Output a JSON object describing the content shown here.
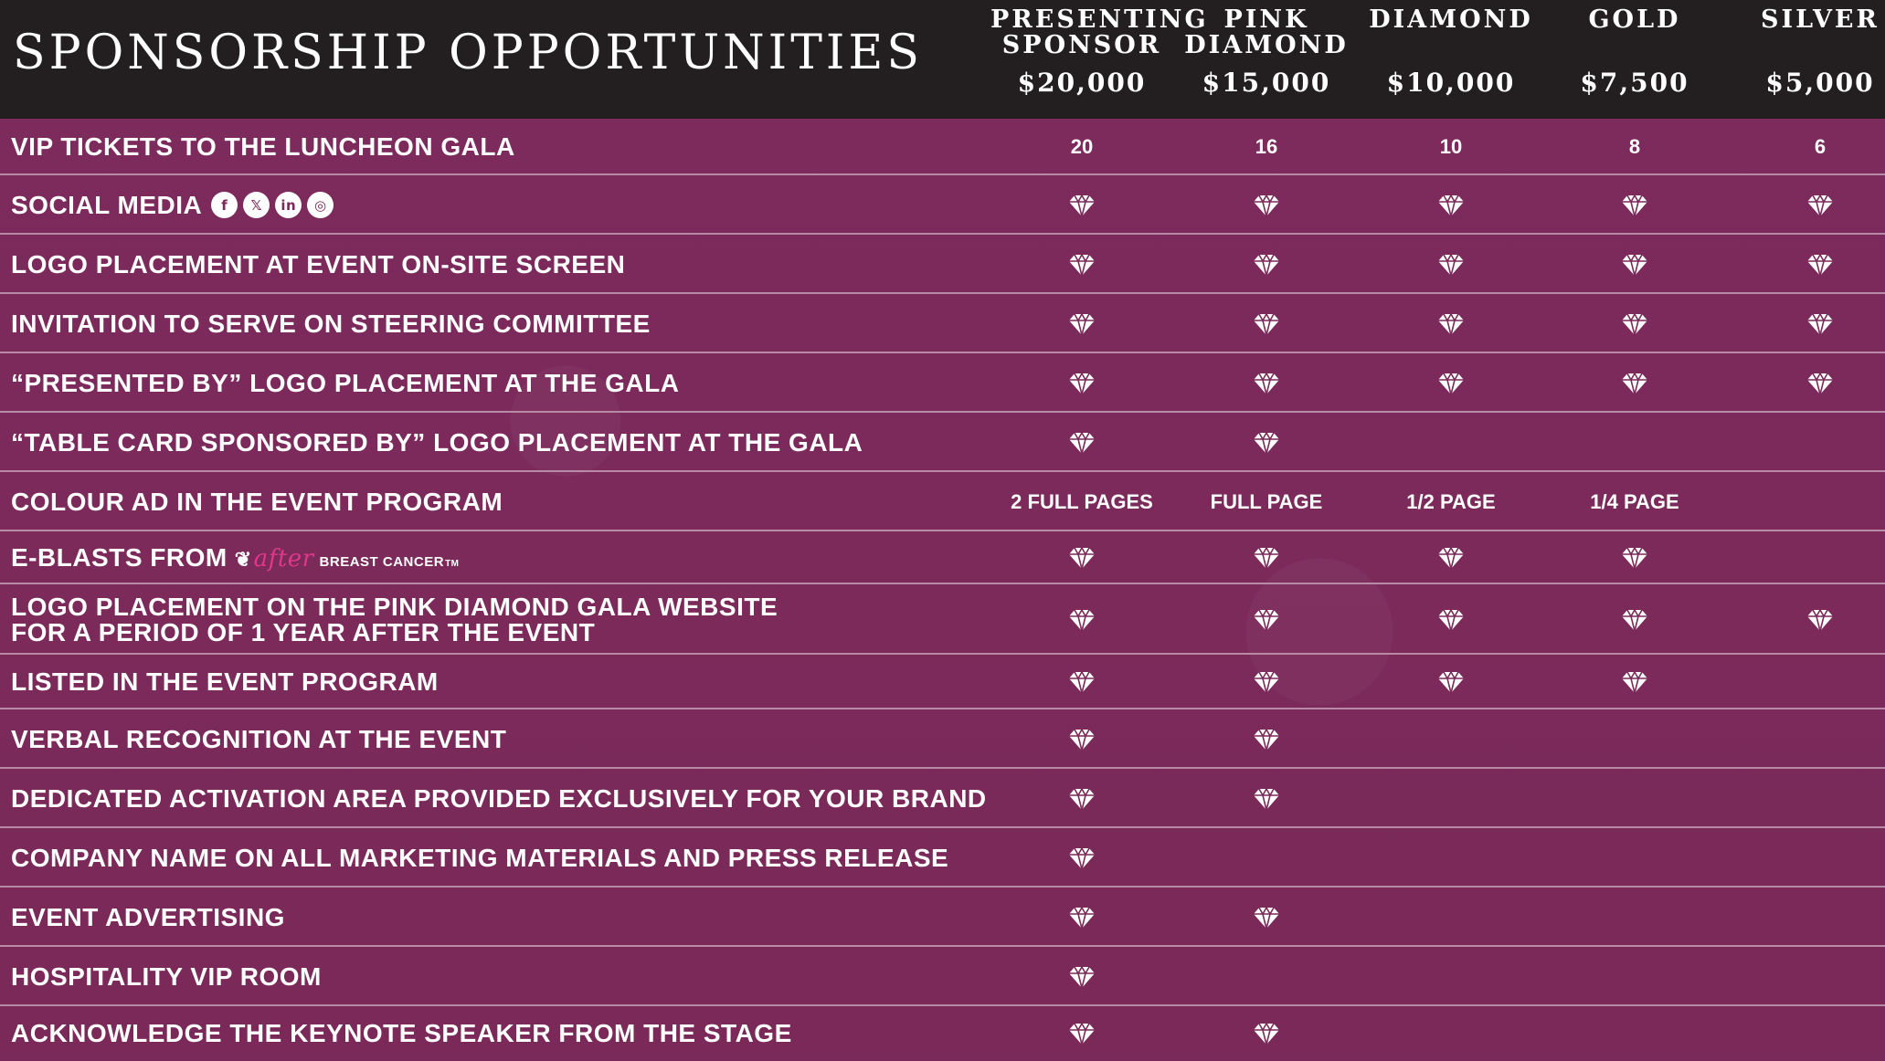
{
  "title": "SPONSORSHIP OPPORTUNITIES",
  "tiers": [
    {
      "name": "PRESENTING\nSPONSOR",
      "price": "$20,000"
    },
    {
      "name": "PINK\nDIAMOND",
      "price": "$15,000"
    },
    {
      "name": "DIAMOND",
      "price": "$10,000"
    },
    {
      "name": "GOLD",
      "price": "$7,500"
    },
    {
      "name": "SILVER",
      "price": "$5,000"
    }
  ],
  "social_icons": [
    "facebook-icon",
    "x-icon",
    "linkedin-icon",
    "instagram-icon"
  ],
  "brand": {
    "mark": "❦",
    "after": "after",
    "rest": "BREAST CANCER",
    "tm": "TM"
  },
  "benefits": [
    {
      "label": "VIP TICKETS TO THE LUNCHEON GALA",
      "values": [
        "20",
        "16",
        "10",
        "8",
        "6"
      ]
    },
    {
      "label": "SOCIAL MEDIA",
      "values": [
        true,
        true,
        true,
        true,
        true
      ],
      "extra": "social"
    },
    {
      "label": "LOGO PLACEMENT AT EVENT ON-SITE SCREEN",
      "values": [
        true,
        true,
        true,
        true,
        true
      ]
    },
    {
      "label": "INVITATION TO SERVE ON STEERING COMMITTEE",
      "values": [
        true,
        true,
        true,
        true,
        true
      ]
    },
    {
      "label": "“PRESENTED BY” LOGO PLACEMENT AT THE GALA",
      "values": [
        true,
        true,
        true,
        true,
        true
      ]
    },
    {
      "label": "“TABLE CARD SPONSORED BY” LOGO PLACEMENT AT THE GALA",
      "values": [
        true,
        true,
        false,
        false,
        false
      ]
    },
    {
      "label": "COLOUR AD IN THE EVENT PROGRAM",
      "values": [
        "2 FULL PAGES",
        "FULL PAGE",
        "1/2 PAGE",
        "1/4 PAGE",
        false
      ]
    },
    {
      "label": "E-BLASTS FROM",
      "values": [
        true,
        true,
        true,
        true,
        false
      ],
      "extra": "brand"
    },
    {
      "label": "LOGO PLACEMENT ON THE PINK DIAMOND GALA WEBSITE\nFOR A PERIOD OF 1 YEAR AFTER THE EVENT",
      "values": [
        true,
        true,
        true,
        true,
        true
      ]
    },
    {
      "label": "LISTED IN THE EVENT PROGRAM",
      "values": [
        true,
        true,
        true,
        true,
        false
      ]
    },
    {
      "label": "VERBAL RECOGNITION AT THE EVENT",
      "values": [
        true,
        true,
        false,
        false,
        false
      ]
    },
    {
      "label": "DEDICATED ACTIVATION AREA PROVIDED EXCLUSIVELY FOR YOUR BRAND",
      "values": [
        true,
        true,
        false,
        false,
        false
      ]
    },
    {
      "label": "COMPANY NAME ON ALL MARKETING MATERIALS AND PRESS RELEASE",
      "values": [
        true,
        false,
        false,
        false,
        false
      ]
    },
    {
      "label": "EVENT ADVERTISING",
      "values": [
        true,
        true,
        false,
        false,
        false
      ]
    },
    {
      "label": "HOSPITALITY VIP ROOM",
      "values": [
        true,
        false,
        false,
        false,
        false
      ]
    },
    {
      "label": "ACKNOWLEDGE THE KEYNOTE SPEAKER FROM THE STAGE",
      "values": [
        true,
        true,
        false,
        false,
        false
      ]
    }
  ]
}
